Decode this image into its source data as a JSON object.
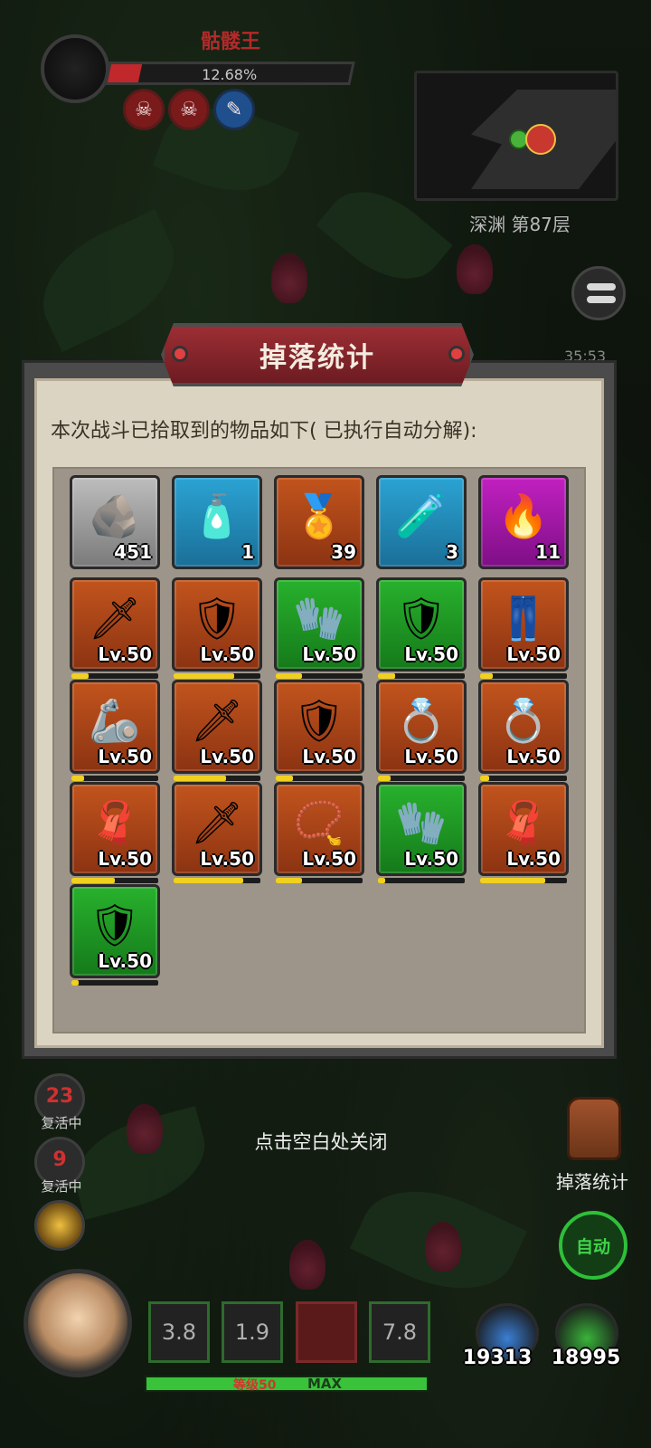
{
  "boss": {
    "name": "骷髅王",
    "hp_percent_text": "12.68%",
    "hp_fraction": 0.1268
  },
  "buffs": [
    {
      "icon": "skull-icon",
      "glyph": "☠"
    },
    {
      "icon": "skull-icon",
      "glyph": "☠"
    },
    {
      "icon": "potion-icon",
      "glyph": "✎"
    }
  ],
  "map": {
    "floor_label": "深渊 第87层"
  },
  "panel": {
    "title": "掉落统计",
    "description": "本次战斗已拾取到的物品如下( 已执行自动分解):",
    "close_hint": "点击空白处关闭"
  },
  "items": [
    {
      "icon": "ore-icon",
      "glyph": "🪨",
      "quality": "gray",
      "label": "451"
    },
    {
      "icon": "blue-potion-icon",
      "glyph": "🧴",
      "quality": "blue",
      "label": "1"
    },
    {
      "icon": "gold-medal-icon",
      "glyph": "🏅",
      "quality": "orange",
      "label": "39"
    },
    {
      "icon": "green-potion-icon",
      "glyph": "🧪",
      "quality": "blue",
      "label": "3"
    },
    {
      "icon": "fire-essence-icon",
      "glyph": "🔥",
      "quality": "purple",
      "label": "11"
    },
    {
      "icon": "sword-icon",
      "glyph": "🗡",
      "quality": "orange",
      "label": "Lv.50",
      "progress": 0.2
    },
    {
      "icon": "chest-armor-icon",
      "glyph": "🛡",
      "quality": "orange",
      "label": "Lv.50",
      "progress": 0.7
    },
    {
      "icon": "gauntlet-icon",
      "glyph": "🧤",
      "quality": "green",
      "label": "Lv.50",
      "progress": 0.3
    },
    {
      "icon": "pauldron-icon",
      "glyph": "🛡",
      "quality": "green",
      "label": "Lv.50",
      "progress": 0.2
    },
    {
      "icon": "pants-icon",
      "glyph": "👖",
      "quality": "orange",
      "label": "Lv.50",
      "progress": 0.15
    },
    {
      "icon": "bracer-icon",
      "glyph": "🦾",
      "quality": "orange",
      "label": "Lv.50",
      "progress": 0.15
    },
    {
      "icon": "ice-sword-icon",
      "glyph": "🗡",
      "quality": "orange",
      "label": "Lv.50",
      "progress": 0.6
    },
    {
      "icon": "shield-icon",
      "glyph": "🛡",
      "quality": "orange",
      "label": "Lv.50",
      "progress": 0.2
    },
    {
      "icon": "ring-icon",
      "glyph": "💍",
      "quality": "orange",
      "label": "Lv.50",
      "progress": 0.15
    },
    {
      "icon": "sapphire-ring-icon",
      "glyph": "💍",
      "quality": "orange",
      "label": "Lv.50",
      "progress": 0.1
    },
    {
      "icon": "cloak-icon",
      "glyph": "🧣",
      "quality": "orange",
      "label": "Lv.50",
      "progress": 0.5
    },
    {
      "icon": "spiked-sword-icon",
      "glyph": "🗡",
      "quality": "orange",
      "label": "Lv.50",
      "progress": 0.8
    },
    {
      "icon": "amulet-icon",
      "glyph": "📿",
      "quality": "orange",
      "label": "Lv.50",
      "progress": 0.3
    },
    {
      "icon": "gauntlet-icon",
      "glyph": "🧤",
      "quality": "green",
      "label": "Lv.50",
      "progress": 0.08
    },
    {
      "icon": "cloak-icon",
      "glyph": "🧣",
      "quality": "orange",
      "label": "Lv.50",
      "progress": 0.75
    },
    {
      "icon": "pauldron-icon",
      "glyph": "🛡",
      "quality": "green",
      "label": "Lv.50",
      "progress": 0.08
    }
  ],
  "revives": [
    {
      "count": "23",
      "label": "复活中"
    },
    {
      "count": "9",
      "label": "复活中"
    }
  ],
  "bag": {
    "label": "掉落统计"
  },
  "auto_button": {
    "label": "自动"
  },
  "skills": [
    {
      "cooldown": "3.8"
    },
    {
      "cooldown": "1.9"
    },
    {
      "cooldown": ""
    },
    {
      "cooldown": "7.8"
    }
  ],
  "xp": {
    "level_text": "等级50",
    "max_text": "MAX"
  },
  "potions": [
    {
      "icon": "hp-potion-icon",
      "count": "19313",
      "color": "#3a7fd5"
    },
    {
      "icon": "mp-potion-icon",
      "count": "18995",
      "color": "#39b43a"
    }
  ],
  "timer": {
    "text": "35:53"
  }
}
